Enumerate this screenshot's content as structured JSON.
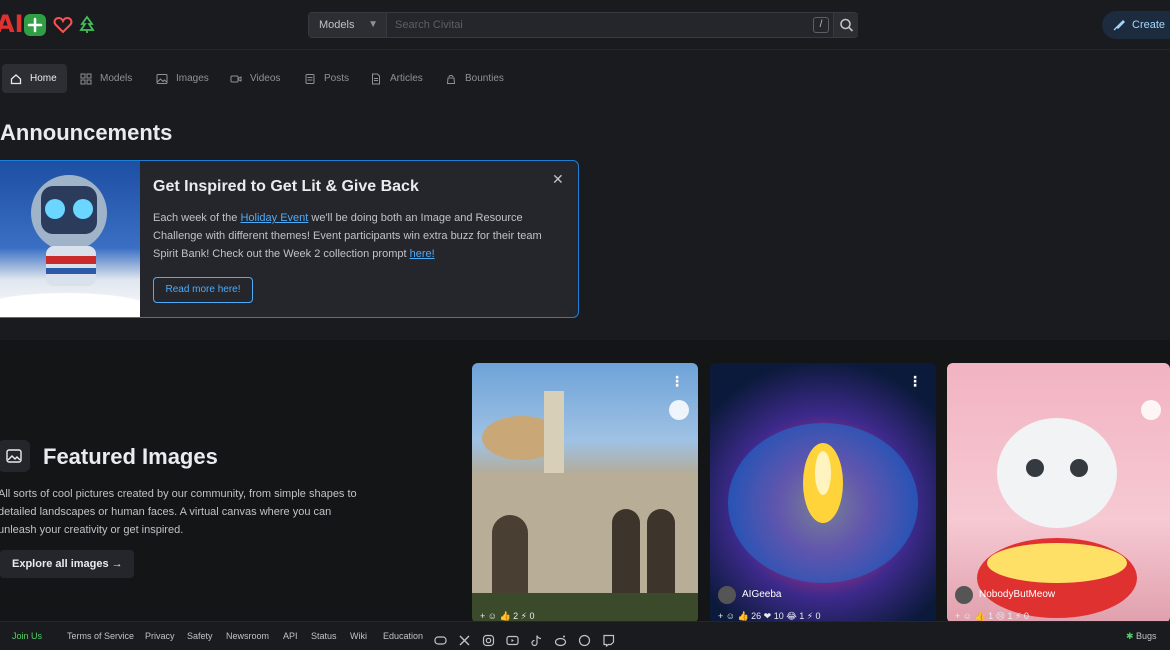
{
  "header": {
    "search_scope": "Models",
    "search_placeholder": "Search Civitai",
    "shortcut_key": "/",
    "create_label": "Create"
  },
  "nav": {
    "items": [
      {
        "label": "Home",
        "icon": "home-icon",
        "active": true
      },
      {
        "label": "Models",
        "icon": "grid-icon"
      },
      {
        "label": "Images",
        "icon": "image-icon"
      },
      {
        "label": "Videos",
        "icon": "video-icon"
      },
      {
        "label": "Posts",
        "icon": "posts-icon"
      },
      {
        "label": "Articles",
        "icon": "article-icon"
      },
      {
        "label": "Bounties",
        "icon": "bounty-icon"
      }
    ]
  },
  "announcements": {
    "section_title": "Announcements",
    "card": {
      "title": "Get Inspired to Get Lit & Give Back",
      "body_1": "Each week of the ",
      "link_1": "Holiday Event",
      "body_2": " we'll be doing both an Image and Resource Challenge with different themes! Event participants win extra buzz for their team Spirit Bank! Check out the Week 2 collection prompt ",
      "link_2": "here!",
      "button": "Read more here!"
    }
  },
  "featured": {
    "title": "Featured Images",
    "description": "All sorts of cool pictures created by our community, from simple shapes to detailed landscapes or human faces. A virtual canvas where you can unleash your creativity or get inspired.",
    "explore_label": "Explore all images",
    "cards": [
      {
        "user": "",
        "stats": "+ ☺ 👍 2 ⚡ 0"
      },
      {
        "user": "AIGeeba",
        "stats": "+ ☺ 👍 26 ❤ 10 😂 1 ⚡ 0"
      },
      {
        "user": "NobodyButMeow",
        "stats": "+ ☺ 👍 1 😢 1 ⚡ 0"
      }
    ]
  },
  "footer": {
    "links": [
      "Join Us",
      "Terms of Service",
      "Privacy",
      "Safety",
      "Newsroom",
      "API",
      "Status",
      "Wiki",
      "Education"
    ],
    "bugs": "Bugs"
  },
  "colors": {
    "background": "#1a1b1e",
    "accent": "#1c7ed6",
    "link": "#4dabf7",
    "green": "#2f9e44",
    "brand_red": "#e03131"
  }
}
